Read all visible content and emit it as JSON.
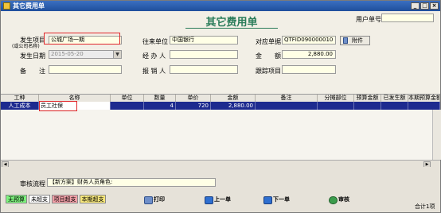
{
  "window": {
    "title": "其它费用单",
    "min": "_",
    "max": "□",
    "close": "×"
  },
  "header": {
    "doc_title": "其它费用单",
    "user_no_label": "用户单号",
    "user_no_value": "",
    "occur_project_label": "发生项目",
    "occur_project_sub": "(或公司名称)",
    "occur_project_value": "公城广场一期",
    "partner_label": "往来单位",
    "partner_value": "中国银行",
    "ref_doc_label": "对应单据",
    "ref_doc_value": "QTFID090000010",
    "attach_label": "附件",
    "date_label": "发生日期",
    "date_value": "2015-05-20",
    "handler_label": "经 办 人",
    "handler_value": "",
    "amount_label": "金　　额",
    "amount_value": "2,880.00",
    "note_label": "备　　注",
    "note_value": "",
    "reporter_label": "报 销 人",
    "reporter_value": "",
    "track_label": "跟踪项目",
    "track_value": ""
  },
  "grid": {
    "columns": [
      "工种",
      "名称",
      "单位",
      "数量",
      "单价",
      "金额",
      "备注",
      "分摊部位",
      "预算金额",
      "已发生额",
      "本期预算金额"
    ],
    "rows": [
      {
        "type": "人工成本",
        "name": "员工社保",
        "unit": "",
        "qty": "4",
        "price": "720",
        "amount": "2,880.00",
        "note": "",
        "part": "",
        "budget": "",
        "occurred": "",
        "period_budget": ""
      }
    ]
  },
  "footer": {
    "flow_label": "审核流程",
    "flow_value": "【新方案】财务人员角色:",
    "legend": [
      {
        "label": "无预算",
        "color": "#7df27d"
      },
      {
        "label": "未超支",
        "color": "#ffffff"
      },
      {
        "label": "项目超支",
        "color": "#f4a0a8"
      },
      {
        "label": "本期超支",
        "color": "#f7e77a"
      }
    ],
    "print_label": "打印",
    "prev_label": "上一单",
    "next_label": "下一单",
    "audit_label": "审核",
    "total_label": "合计1项"
  },
  "colors": {
    "accent_title": "#2a7c5a",
    "selection": "#1d2a8f",
    "highlight_box": "#e0262a"
  }
}
